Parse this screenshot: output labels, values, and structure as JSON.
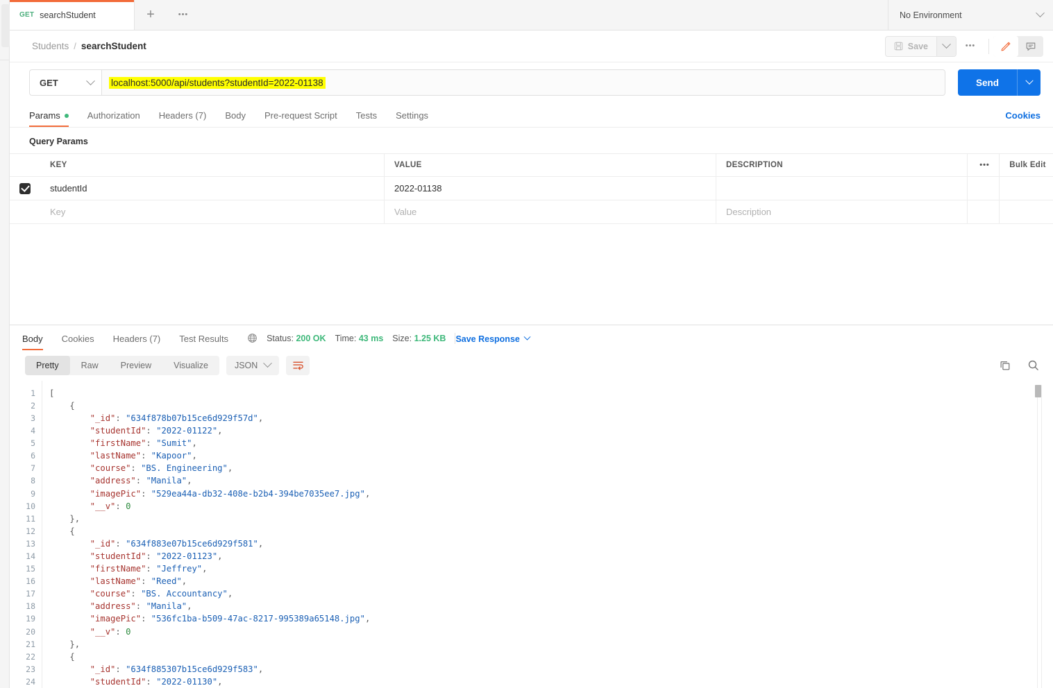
{
  "window": {
    "environment_selector": "No Environment"
  },
  "tabs": {
    "request_tab": {
      "method": "GET",
      "name": "searchStudent"
    },
    "new_tab_label": "+",
    "tab_options_label": "•••"
  },
  "breadcrumb": {
    "collection": "Students",
    "separator": "/",
    "request": "searchStudent"
  },
  "header_actions": {
    "save_label": "Save",
    "more_label": "•••"
  },
  "url_bar": {
    "method": "GET",
    "url": "localhost:5000/api/students?studentId=2022-01138",
    "send_label": "Send"
  },
  "request_tabs": {
    "items": [
      {
        "label": "Params",
        "has_dot": true
      },
      {
        "label": "Authorization",
        "has_dot": false
      },
      {
        "label": "Headers (7)",
        "has_dot": false
      },
      {
        "label": "Body",
        "has_dot": false
      },
      {
        "label": "Pre-request Script",
        "has_dot": false
      },
      {
        "label": "Tests",
        "has_dot": false
      },
      {
        "label": "Settings",
        "has_dot": false
      }
    ],
    "active_index": 0,
    "cookies_label": "Cookies"
  },
  "query_params": {
    "section_title": "Query Params",
    "columns": {
      "key": "KEY",
      "value": "VALUE",
      "description": "DESCRIPTION"
    },
    "options_label": "•••",
    "bulk_edit_label": "Bulk Edit",
    "rows": [
      {
        "checked": true,
        "key": "studentId",
        "value": "2022-01138",
        "description": ""
      }
    ],
    "placeholder_row": {
      "key": "Key",
      "value": "Value",
      "description": "Description"
    }
  },
  "response": {
    "tabs": [
      {
        "label": "Body"
      },
      {
        "label": "Cookies"
      },
      {
        "label": "Headers (7)"
      },
      {
        "label": "Test Results"
      }
    ],
    "active_tab_index": 0,
    "status_label": "Status:",
    "status_value": "200 OK",
    "time_label": "Time:",
    "time_value": "43 ms",
    "size_label": "Size:",
    "size_value": "1.25 KB",
    "save_response_label": "Save Response",
    "view_modes": [
      "Pretty",
      "Raw",
      "Preview",
      "Visualize"
    ],
    "active_view_mode": "Pretty",
    "format": "JSON",
    "colors": {
      "accent": "#f26b3a",
      "send_blue": "#0f73e8",
      "link_blue": "#0f6fe0",
      "status_green": "#3eb87a"
    }
  },
  "code": {
    "line_numbers": [
      1,
      2,
      3,
      4,
      5,
      6,
      7,
      8,
      9,
      10,
      11,
      12,
      13,
      14,
      15,
      16,
      17,
      18,
      19,
      20,
      21,
      22,
      23,
      24
    ],
    "lines": [
      {
        "indent": 0,
        "tokens": [
          {
            "t": "p",
            "v": "["
          }
        ]
      },
      {
        "indent": 1,
        "tokens": [
          {
            "t": "p",
            "v": "{"
          }
        ]
      },
      {
        "indent": 2,
        "tokens": [
          {
            "t": "k",
            "v": "\"_id\""
          },
          {
            "t": "p",
            "v": ": "
          },
          {
            "t": "s",
            "v": "\"634f878b07b15ce6d929f57d\""
          },
          {
            "t": "p",
            "v": ","
          }
        ]
      },
      {
        "indent": 2,
        "tokens": [
          {
            "t": "k",
            "v": "\"studentId\""
          },
          {
            "t": "p",
            "v": ": "
          },
          {
            "t": "s",
            "v": "\"2022-01122\""
          },
          {
            "t": "p",
            "v": ","
          }
        ]
      },
      {
        "indent": 2,
        "tokens": [
          {
            "t": "k",
            "v": "\"firstName\""
          },
          {
            "t": "p",
            "v": ": "
          },
          {
            "t": "s",
            "v": "\"Sumit\""
          },
          {
            "t": "p",
            "v": ","
          }
        ]
      },
      {
        "indent": 2,
        "tokens": [
          {
            "t": "k",
            "v": "\"lastName\""
          },
          {
            "t": "p",
            "v": ": "
          },
          {
            "t": "s",
            "v": "\"Kapoor\""
          },
          {
            "t": "p",
            "v": ","
          }
        ]
      },
      {
        "indent": 2,
        "tokens": [
          {
            "t": "k",
            "v": "\"course\""
          },
          {
            "t": "p",
            "v": ": "
          },
          {
            "t": "s",
            "v": "\"BS. Engineering\""
          },
          {
            "t": "p",
            "v": ","
          }
        ]
      },
      {
        "indent": 2,
        "tokens": [
          {
            "t": "k",
            "v": "\"address\""
          },
          {
            "t": "p",
            "v": ": "
          },
          {
            "t": "s",
            "v": "\"Manila\""
          },
          {
            "t": "p",
            "v": ","
          }
        ]
      },
      {
        "indent": 2,
        "tokens": [
          {
            "t": "k",
            "v": "\"imagePic\""
          },
          {
            "t": "p",
            "v": ": "
          },
          {
            "t": "s",
            "v": "\"529ea44a-db32-408e-b2b4-394be7035ee7.jpg\""
          },
          {
            "t": "p",
            "v": ","
          }
        ]
      },
      {
        "indent": 2,
        "tokens": [
          {
            "t": "k",
            "v": "\"__v\""
          },
          {
            "t": "p",
            "v": ": "
          },
          {
            "t": "n",
            "v": "0"
          }
        ]
      },
      {
        "indent": 1,
        "tokens": [
          {
            "t": "p",
            "v": "},"
          }
        ]
      },
      {
        "indent": 1,
        "tokens": [
          {
            "t": "p",
            "v": "{"
          }
        ]
      },
      {
        "indent": 2,
        "tokens": [
          {
            "t": "k",
            "v": "\"_id\""
          },
          {
            "t": "p",
            "v": ": "
          },
          {
            "t": "s",
            "v": "\"634f883e07b15ce6d929f581\""
          },
          {
            "t": "p",
            "v": ","
          }
        ]
      },
      {
        "indent": 2,
        "tokens": [
          {
            "t": "k",
            "v": "\"studentId\""
          },
          {
            "t": "p",
            "v": ": "
          },
          {
            "t": "s",
            "v": "\"2022-01123\""
          },
          {
            "t": "p",
            "v": ","
          }
        ]
      },
      {
        "indent": 2,
        "tokens": [
          {
            "t": "k",
            "v": "\"firstName\""
          },
          {
            "t": "p",
            "v": ": "
          },
          {
            "t": "s",
            "v": "\"Jeffrey\""
          },
          {
            "t": "p",
            "v": ","
          }
        ]
      },
      {
        "indent": 2,
        "tokens": [
          {
            "t": "k",
            "v": "\"lastName\""
          },
          {
            "t": "p",
            "v": ": "
          },
          {
            "t": "s",
            "v": "\"Reed\""
          },
          {
            "t": "p",
            "v": ","
          }
        ]
      },
      {
        "indent": 2,
        "tokens": [
          {
            "t": "k",
            "v": "\"course\""
          },
          {
            "t": "p",
            "v": ": "
          },
          {
            "t": "s",
            "v": "\"BS. Accountancy\""
          },
          {
            "t": "p",
            "v": ","
          }
        ]
      },
      {
        "indent": 2,
        "tokens": [
          {
            "t": "k",
            "v": "\"address\""
          },
          {
            "t": "p",
            "v": ": "
          },
          {
            "t": "s",
            "v": "\"Manila\""
          },
          {
            "t": "p",
            "v": ","
          }
        ]
      },
      {
        "indent": 2,
        "tokens": [
          {
            "t": "k",
            "v": "\"imagePic\""
          },
          {
            "t": "p",
            "v": ": "
          },
          {
            "t": "s",
            "v": "\"536fc1ba-b509-47ac-8217-995389a65148.jpg\""
          },
          {
            "t": "p",
            "v": ","
          }
        ]
      },
      {
        "indent": 2,
        "tokens": [
          {
            "t": "k",
            "v": "\"__v\""
          },
          {
            "t": "p",
            "v": ": "
          },
          {
            "t": "n",
            "v": "0"
          }
        ]
      },
      {
        "indent": 1,
        "tokens": [
          {
            "t": "p",
            "v": "},"
          }
        ]
      },
      {
        "indent": 1,
        "tokens": [
          {
            "t": "p",
            "v": "{"
          }
        ]
      },
      {
        "indent": 2,
        "tokens": [
          {
            "t": "k",
            "v": "\"_id\""
          },
          {
            "t": "p",
            "v": ": "
          },
          {
            "t": "s",
            "v": "\"634f885307b15ce6d929f583\""
          },
          {
            "t": "p",
            "v": ","
          }
        ]
      },
      {
        "indent": 2,
        "tokens": [
          {
            "t": "k",
            "v": "\"studentId\""
          },
          {
            "t": "p",
            "v": ": "
          },
          {
            "t": "s",
            "v": "\"2022-01130\""
          },
          {
            "t": "p",
            "v": ","
          }
        ]
      }
    ]
  }
}
